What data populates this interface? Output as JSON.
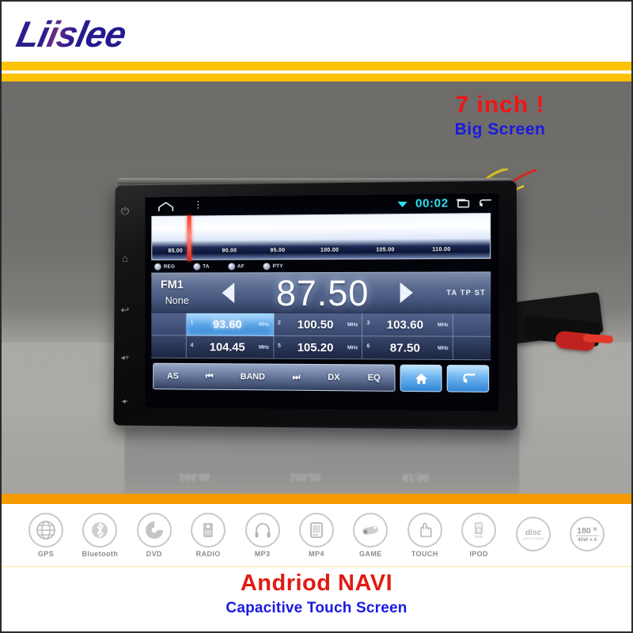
{
  "brand": {
    "logo_text": "Liislee"
  },
  "headline": {
    "line1": "7 inch !",
    "line2": "Big Screen"
  },
  "footer": {
    "title": "Andriod NAVI",
    "subtitle": "Capacitive Touch Screen"
  },
  "colors": {
    "yellow_bar": "#fbc404",
    "orange_bar": "#f59b00",
    "red_text": "#e01b13",
    "blue_text": "#1a1ae0",
    "logo_navy": "#2b1d8c",
    "screen_accent": "#2fe0f5",
    "tuner_marker": "#ff3b30"
  },
  "device": {
    "side_buttons": [
      {
        "name": "power",
        "glyph": "⏻"
      },
      {
        "name": "home",
        "glyph": "⌂"
      },
      {
        "name": "back",
        "glyph": "↩"
      },
      {
        "name": "volume-up",
        "glyph": "◂+"
      },
      {
        "name": "volume-down",
        "glyph": "◂-"
      }
    ],
    "status_bar": {
      "clock": "00:02",
      "wifi_icon": "wifi-icon",
      "recents_icon": "recents-icon",
      "back_icon": "back-icon",
      "home_icon": "home-icon",
      "menu_icon": "overflow-menu-icon"
    },
    "radio": {
      "scale_ticks": [
        "85.00",
        "90.00",
        "95.00",
        "100.00",
        "105.00",
        "110.00"
      ],
      "rds_buttons": [
        "REG",
        "TA",
        "AF",
        "PTY"
      ],
      "band": "FM1",
      "pty_text": "None",
      "frequency": "87.50",
      "indicators": "TA TP ST",
      "unit": "MHz",
      "presets": [
        {
          "num": "1",
          "value": "93.60",
          "unit": "MHz",
          "active": true
        },
        {
          "num": "2",
          "value": "100.50",
          "unit": "MHz",
          "active": false
        },
        {
          "num": "3",
          "value": "103.60",
          "unit": "MHz",
          "active": false
        },
        {
          "num": "4",
          "value": "104.45",
          "unit": "MHz",
          "active": false
        },
        {
          "num": "5",
          "value": "105.20",
          "unit": "MHz",
          "active": false
        },
        {
          "num": "6",
          "value": "87.50",
          "unit": "MHz",
          "active": false
        }
      ],
      "controls": [
        "AS",
        "⏮",
        "BAND",
        "⏭",
        "DX",
        "EQ"
      ],
      "nav_home_icon": "home-icon",
      "nav_back_icon": "back-arrow-icon"
    }
  },
  "features": [
    {
      "label": "GPS",
      "icon": "globe-icon"
    },
    {
      "label": "Bluetooth",
      "icon": "bluetooth-icon"
    },
    {
      "label": "DVD",
      "icon": "disc-icon"
    },
    {
      "label": "RADIO",
      "icon": "radio-icon"
    },
    {
      "label": "MP3",
      "icon": "headphone-icon"
    },
    {
      "label": "MP4",
      "icon": "screen-icon"
    },
    {
      "label": "GAME",
      "icon": "gamepad-icon"
    },
    {
      "label": "TOUCH",
      "icon": "hand-touch-icon"
    },
    {
      "label": "IPOD",
      "icon": "ipod-icon"
    },
    {
      "label": "",
      "icon": "compact-disc-logo"
    },
    {
      "label": "",
      "icon": "power-180w-badge"
    }
  ],
  "badges": {
    "disc_logo": "disc",
    "disc_sub": "DIGITAL AUDIO",
    "power_main": "180",
    "power_unit": "W",
    "power_sub": "45W × 4"
  }
}
